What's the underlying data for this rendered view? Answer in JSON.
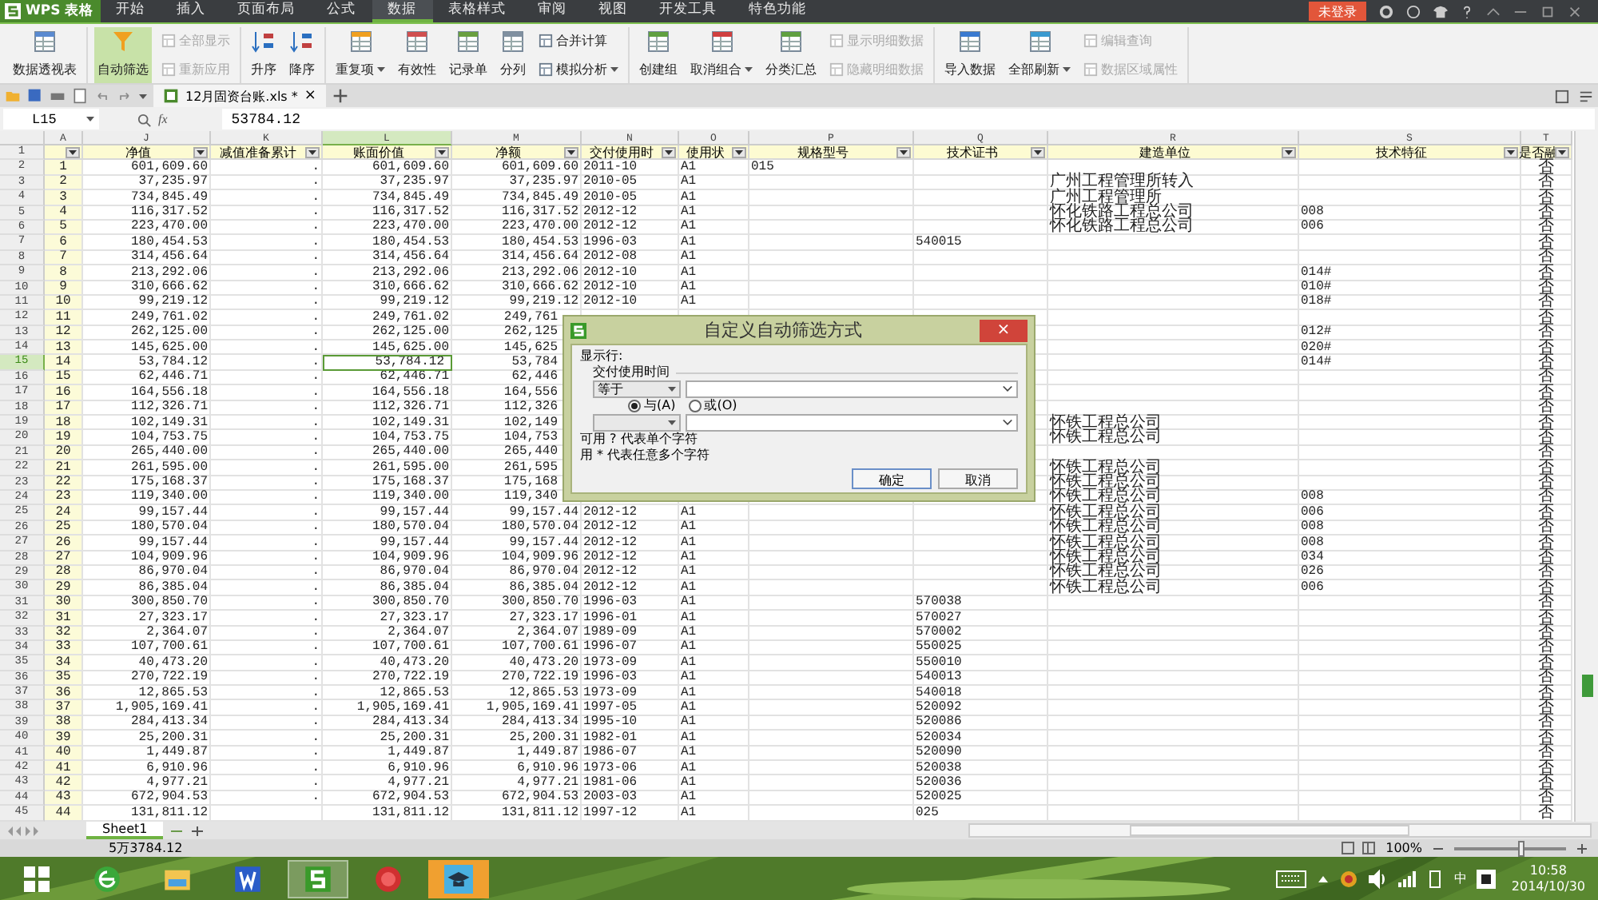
{
  "app": {
    "logo": "WPS 表格",
    "menu": [
      {
        "label": "开始",
        "selected": false
      },
      {
        "label": "插入",
        "selected": false
      },
      {
        "label": "页面布局",
        "selected": false
      },
      {
        "label": "公式",
        "selected": false
      },
      {
        "label": "数据",
        "selected": true
      },
      {
        "label": "表格样式",
        "selected": false
      },
      {
        "label": "审阅",
        "selected": false
      },
      {
        "label": "视图",
        "selected": false
      },
      {
        "label": "开发工具",
        "selected": false
      },
      {
        "label": "特色功能",
        "selected": false
      }
    ],
    "login": "未登录"
  },
  "ribbon": [
    {
      "items": [
        {
          "label": "数据透视表",
          "kind": "large",
          "disabled": false
        }
      ]
    },
    {
      "items": [
        {
          "label": "自动筛选",
          "kind": "large",
          "disabled": false,
          "on": true
        },
        {
          "label": "全部显示",
          "kind": "small",
          "disabled": true
        },
        {
          "label": "重新应用",
          "kind": "small",
          "disabled": true
        }
      ]
    },
    {
      "items": [
        {
          "label": "升序",
          "kind": "large",
          "disabled": false
        },
        {
          "label": "降序",
          "kind": "large",
          "disabled": false
        }
      ]
    },
    {
      "items": [
        {
          "label": "重复项",
          "kind": "large",
          "disabled": false,
          "dropdown": true
        },
        {
          "label": "有效性",
          "kind": "large",
          "disabled": false
        },
        {
          "label": "记录单",
          "kind": "large",
          "disabled": false
        },
        {
          "label": "分列",
          "kind": "large",
          "disabled": false
        },
        {
          "label": "合并计算",
          "kind": "small",
          "disabled": false
        },
        {
          "label": "模拟分析",
          "kind": "small",
          "disabled": false,
          "dropdown": true
        }
      ]
    },
    {
      "items": [
        {
          "label": "创建组",
          "kind": "large",
          "disabled": false
        },
        {
          "label": "取消组合",
          "kind": "large",
          "disabled": false,
          "dropdown": true
        },
        {
          "label": "分类汇总",
          "kind": "large",
          "disabled": false
        },
        {
          "label": "显示明细数据",
          "kind": "small",
          "disabled": true
        },
        {
          "label": "隐藏明细数据",
          "kind": "small",
          "disabled": true
        }
      ]
    },
    {
      "items": [
        {
          "label": "导入数据",
          "kind": "large",
          "disabled": false
        },
        {
          "label": "全部刷新",
          "kind": "large",
          "disabled": false,
          "dropdown": true
        },
        {
          "label": "编辑查询",
          "kind": "small",
          "disabled": true
        },
        {
          "label": "数据区域属性",
          "kind": "small",
          "disabled": true
        }
      ]
    }
  ],
  "document_tab": {
    "title": "12月固资台账.xls *",
    "close": "×",
    "selected": true
  },
  "formula_bar": {
    "name_box": "L15",
    "fx": "fx",
    "value": "53784.12"
  },
  "sheet": {
    "header_row": "1",
    "columns": [
      {
        "letter": "A",
        "selected": false
      },
      {
        "letter": "J",
        "header": "净值",
        "selected": false
      },
      {
        "letter": "K",
        "header": "减值准备累计",
        "selected": false
      },
      {
        "letter": "L",
        "header": "账面价值",
        "selected": true
      },
      {
        "letter": "M",
        "header": "净额",
        "selected": false
      },
      {
        "letter": "N",
        "header": "交付使用时",
        "selected": false
      },
      {
        "letter": "O",
        "header": "使用状",
        "selected": false
      },
      {
        "letter": "P",
        "header": "规格型号",
        "selected": false
      },
      {
        "letter": "Q",
        "header": "技术证书",
        "selected": false
      },
      {
        "letter": "R",
        "header": "建造单位",
        "selected": false
      },
      {
        "letter": "S",
        "header": "技术特征",
        "selected": false
      },
      {
        "letter": "T",
        "header": "是否融",
        "selected": false
      }
    ],
    "rows": [
      {
        "row": "2",
        "selected": false,
        "cells": {
          "A": "1",
          "J": "601,609.60",
          "K": ".",
          "L": "601,609.60",
          "M": "601,609.60",
          "N": "2011-10",
          "O": "A1",
          "P": "015",
          "T": "否"
        }
      },
      {
        "row": "3",
        "selected": false,
        "cells": {
          "A": "2",
          "J": "37,235.97",
          "K": ".",
          "L": "37,235.97",
          "M": "37,235.97",
          "N": "2010-05",
          "O": "A1",
          "R": "广州工程管理所转入",
          "T": "否"
        }
      },
      {
        "row": "4",
        "selected": false,
        "cells": {
          "A": "3",
          "J": "734,845.49",
          "K": ".",
          "L": "734,845.49",
          "M": "734,845.49",
          "N": "2010-05",
          "O": "A1",
          "R": "广州工程管理所",
          "T": "否"
        }
      },
      {
        "row": "5",
        "selected": false,
        "cells": {
          "A": "4",
          "J": "116,317.52",
          "K": ".",
          "L": "116,317.52",
          "M": "116,317.52",
          "N": "2012-12",
          "O": "A1",
          "R": "怀化铁路工程总公司",
          "S": "008",
          "T": "否"
        }
      },
      {
        "row": "6",
        "selected": false,
        "cells": {
          "A": "5",
          "J": "223,470.00",
          "K": ".",
          "L": "223,470.00",
          "M": "223,470.00",
          "N": "2012-12",
          "O": "A1",
          "R": "怀化铁路工程总公司",
          "S": "006",
          "T": "否"
        }
      },
      {
        "row": "7",
        "selected": false,
        "cells": {
          "A": "6",
          "J": "180,454.53",
          "K": ".",
          "L": "180,454.53",
          "M": "180,454.53",
          "N": "1996-03",
          "O": "A1",
          "Q": "540015",
          "T": "否"
        }
      },
      {
        "row": "8",
        "selected": false,
        "cells": {
          "A": "7",
          "J": "314,456.64",
          "K": ".",
          "L": "314,456.64",
          "M": "314,456.64",
          "N": "2012-08",
          "O": "A1",
          "T": "否"
        }
      },
      {
        "row": "9",
        "selected": false,
        "cells": {
          "A": "8",
          "J": "213,292.06",
          "K": ".",
          "L": "213,292.06",
          "M": "213,292.06",
          "N": "2012-10",
          "O": "A1",
          "S": "014#",
          "T": "否"
        }
      },
      {
        "row": "10",
        "selected": false,
        "cells": {
          "A": "9",
          "J": "310,666.62",
          "K": ".",
          "L": "310,666.62",
          "M": "310,666.62",
          "N": "2012-10",
          "O": "A1",
          "S": "010#",
          "T": "否"
        }
      },
      {
        "row": "11",
        "selected": false,
        "cells": {
          "A": "10",
          "J": "99,219.12",
          "K": ".",
          "L": "99,219.12",
          "M": "99,219.12",
          "N": "2012-10",
          "O": "A1",
          "S": "018#",
          "T": "否"
        }
      },
      {
        "row": "12",
        "selected": false,
        "cells": {
          "A": "11",
          "J": "249,761.02",
          "K": ".",
          "L": "249,761.02",
          "M": "249,761",
          "T": "否"
        }
      },
      {
        "row": "13",
        "selected": false,
        "cells": {
          "A": "12",
          "J": "262,125.00",
          "K": ".",
          "L": "262,125.00",
          "M": "262,125",
          "S": "012#",
          "T": "否"
        }
      },
      {
        "row": "14",
        "selected": false,
        "cells": {
          "A": "13",
          "J": "145,625.00",
          "K": ".",
          "L": "145,625.00",
          "M": "145,625",
          "S": "020#",
          "T": "否"
        }
      },
      {
        "row": "15",
        "selected": true,
        "cells": {
          "A": "14",
          "J": "53,784.12",
          "K": ".",
          "L": "53,784.12",
          "M": "53,784",
          "S": "014#",
          "T": "否"
        }
      },
      {
        "row": "16",
        "selected": false,
        "cells": {
          "A": "15",
          "J": "62,446.71",
          "K": ".",
          "L": "62,446.71",
          "M": "62,446",
          "T": "否"
        }
      },
      {
        "row": "17",
        "selected": false,
        "cells": {
          "A": "16",
          "J": "164,556.18",
          "K": ".",
          "L": "164,556.18",
          "M": "164,556",
          "T": "否"
        }
      },
      {
        "row": "18",
        "selected": false,
        "cells": {
          "A": "17",
          "J": "112,326.71",
          "K": ".",
          "L": "112,326.71",
          "M": "112,326",
          "T": "否"
        }
      },
      {
        "row": "19",
        "selected": false,
        "cells": {
          "A": "18",
          "J": "102,149.31",
          "K": ".",
          "L": "102,149.31",
          "M": "102,149",
          "R": "怀铁工程总公司",
          "T": "否"
        }
      },
      {
        "row": "20",
        "selected": false,
        "cells": {
          "A": "19",
          "J": "104,753.75",
          "K": ".",
          "L": "104,753.75",
          "M": "104,753",
          "R": "怀铁工程总公司",
          "T": "否"
        }
      },
      {
        "row": "21",
        "selected": false,
        "cells": {
          "A": "20",
          "J": "265,440.00",
          "K": ".",
          "L": "265,440.00",
          "M": "265,440",
          "T": "否"
        }
      },
      {
        "row": "22",
        "selected": false,
        "cells": {
          "A": "21",
          "J": "261,595.00",
          "K": ".",
          "L": "261,595.00",
          "M": "261,595",
          "R": "怀铁工程总公司",
          "T": "否"
        }
      },
      {
        "row": "23",
        "selected": false,
        "cells": {
          "A": "22",
          "J": "175,168.37",
          "K": ".",
          "L": "175,168.37",
          "M": "175,168",
          "R": "怀铁工程总公司",
          "T": "否"
        }
      },
      {
        "row": "24",
        "selected": false,
        "cells": {
          "A": "23",
          "J": "119,340.00",
          "K": ".",
          "L": "119,340.00",
          "M": "119,340",
          "R": "怀铁工程总公司",
          "S": "008",
          "T": "否"
        }
      },
      {
        "row": "25",
        "selected": false,
        "cells": {
          "A": "24",
          "J": "99,157.44",
          "K": ".",
          "L": "99,157.44",
          "M": "99,157.44",
          "N": "2012-12",
          "O": "A1",
          "R": "怀铁工程总公司",
          "S": "006",
          "T": "否"
        }
      },
      {
        "row": "26",
        "selected": false,
        "cells": {
          "A": "25",
          "J": "180,570.04",
          "K": ".",
          "L": "180,570.04",
          "M": "180,570.04",
          "N": "2012-12",
          "O": "A1",
          "R": "怀铁工程总公司",
          "S": "008",
          "T": "否"
        }
      },
      {
        "row": "27",
        "selected": false,
        "cells": {
          "A": "26",
          "J": "99,157.44",
          "K": ".",
          "L": "99,157.44",
          "M": "99,157.44",
          "N": "2012-12",
          "O": "A1",
          "R": "怀铁工程总公司",
          "S": "008",
          "T": "否"
        }
      },
      {
        "row": "28",
        "selected": false,
        "cells": {
          "A": "27",
          "J": "104,909.96",
          "K": ".",
          "L": "104,909.96",
          "M": "104,909.96",
          "N": "2012-12",
          "O": "A1",
          "R": "怀铁工程总公司",
          "S": "034",
          "T": "否"
        }
      },
      {
        "row": "29",
        "selected": false,
        "cells": {
          "A": "28",
          "J": "86,970.04",
          "K": ".",
          "L": "86,970.04",
          "M": "86,970.04",
          "N": "2012-12",
          "O": "A1",
          "R": "怀铁工程总公司",
          "S": "026",
          "T": "否"
        }
      },
      {
        "row": "30",
        "selected": false,
        "cells": {
          "A": "29",
          "J": "86,385.04",
          "K": ".",
          "L": "86,385.04",
          "M": "86,385.04",
          "N": "2012-12",
          "O": "A1",
          "R": "怀铁工程总公司",
          "S": "006",
          "T": "否"
        }
      },
      {
        "row": "31",
        "selected": false,
        "cells": {
          "A": "30",
          "J": "300,850.70",
          "K": ".",
          "L": "300,850.70",
          "M": "300,850.70",
          "N": "1996-03",
          "O": "A1",
          "Q": "570038",
          "T": "否"
        }
      },
      {
        "row": "32",
        "selected": false,
        "cells": {
          "A": "31",
          "J": "27,323.17",
          "K": ".",
          "L": "27,323.17",
          "M": "27,323.17",
          "N": "1996-01",
          "O": "A1",
          "Q": "570027",
          "T": "否"
        }
      },
      {
        "row": "33",
        "selected": false,
        "cells": {
          "A": "32",
          "J": "2,364.07",
          "K": ".",
          "L": "2,364.07",
          "M": "2,364.07",
          "N": "1989-09",
          "O": "A1",
          "Q": "570002",
          "T": "否"
        }
      },
      {
        "row": "34",
        "selected": false,
        "cells": {
          "A": "33",
          "J": "107,700.61",
          "K": ".",
          "L": "107,700.61",
          "M": "107,700.61",
          "N": "1996-07",
          "O": "A1",
          "Q": "550025",
          "T": "否"
        }
      },
      {
        "row": "35",
        "selected": false,
        "cells": {
          "A": "34",
          "J": "40,473.20",
          "K": ".",
          "L": "40,473.20",
          "M": "40,473.20",
          "N": "1973-09",
          "O": "A1",
          "Q": "550010",
          "T": "否"
        }
      },
      {
        "row": "36",
        "selected": false,
        "cells": {
          "A": "35",
          "J": "270,722.19",
          "K": ".",
          "L": "270,722.19",
          "M": "270,722.19",
          "N": "1996-03",
          "O": "A1",
          "Q": "540013",
          "T": "否"
        }
      },
      {
        "row": "37",
        "selected": false,
        "cells": {
          "A": "36",
          "J": "12,865.53",
          "K": ".",
          "L": "12,865.53",
          "M": "12,865.53",
          "N": "1973-09",
          "O": "A1",
          "Q": "540018",
          "T": "否"
        }
      },
      {
        "row": "38",
        "selected": false,
        "cells": {
          "A": "37",
          "J": "1,905,169.41",
          "K": ".",
          "L": "1,905,169.41",
          "M": "1,905,169.41",
          "N": "1997-05",
          "O": "A1",
          "Q": "520092",
          "T": "否"
        }
      },
      {
        "row": "39",
        "selected": false,
        "cells": {
          "A": "38",
          "J": "284,413.34",
          "K": ".",
          "L": "284,413.34",
          "M": "284,413.34",
          "N": "1995-10",
          "O": "A1",
          "Q": "520086",
          "T": "否"
        }
      },
      {
        "row": "40",
        "selected": false,
        "cells": {
          "A": "39",
          "J": "25,200.31",
          "K": ".",
          "L": "25,200.31",
          "M": "25,200.31",
          "N": "1982-01",
          "O": "A1",
          "Q": "520034",
          "T": "否"
        }
      },
      {
        "row": "41",
        "selected": false,
        "cells": {
          "A": "40",
          "J": "1,449.87",
          "K": ".",
          "L": "1,449.87",
          "M": "1,449.87",
          "N": "1986-07",
          "O": "A1",
          "Q": "520090",
          "T": "否"
        }
      },
      {
        "row": "42",
        "selected": false,
        "cells": {
          "A": "41",
          "J": "6,910.96",
          "K": ".",
          "L": "6,910.96",
          "M": "6,910.96",
          "N": "1973-06",
          "O": "A1",
          "Q": "520038",
          "T": "否"
        }
      },
      {
        "row": "43",
        "selected": false,
        "cells": {
          "A": "42",
          "J": "4,977.21",
          "K": ".",
          "L": "4,977.21",
          "M": "4,977.21",
          "N": "1981-06",
          "O": "A1",
          "Q": "520036",
          "T": "否"
        }
      },
      {
        "row": "44",
        "selected": false,
        "cells": {
          "A": "43",
          "J": "672,904.53",
          "K": ".",
          "L": "672,904.53",
          "M": "672,904.53",
          "N": "2003-03",
          "O": "A1",
          "Q": "520025",
          "T": "否"
        }
      },
      {
        "row": "45",
        "selected": false,
        "cells": {
          "A": "44",
          "J": "131,811.12",
          "L": "131,811.12",
          "M": "131,811.12",
          "N": "1997-12",
          "O": "A1",
          "Q": "025",
          "T": "否"
        }
      }
    ]
  },
  "dialog": {
    "title": "自定义自动筛选方式",
    "close": "×",
    "show_rows": "显示行:",
    "field": "交付使用时间",
    "operator_1": "等于",
    "options": [
      {
        "label": "与(A)",
        "selected": true
      },
      {
        "label": "或(O)",
        "selected": false
      }
    ],
    "hints": [
      "可用 ? 代表单个字符",
      "用 * 代表任意多个字符"
    ],
    "buttons": [
      "确定",
      "取消"
    ]
  },
  "sheet_tabs": [
    {
      "label": "Sheet1",
      "selected": true
    }
  ],
  "status_bar": {
    "text": "5万3784.12",
    "zoom": "100%",
    "zoom_level": {
      "level": 0.6
    }
  },
  "taskbar": {
    "ime": "中",
    "time": "10:58",
    "date": "2014/10/30"
  }
}
